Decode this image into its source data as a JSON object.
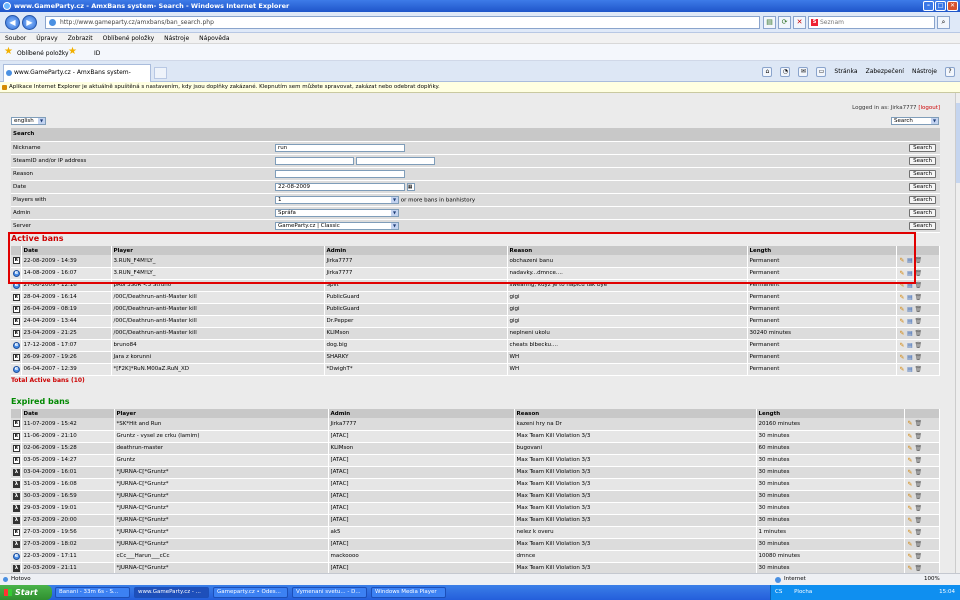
{
  "window": {
    "title": "www.GameParty.cz - AmxBans system- Search - Windows Internet Explorer"
  },
  "address": {
    "url": "http://www.gameparty.cz/amxbans/ban_search.php",
    "search_placeholder": "Seznam"
  },
  "menu": [
    "Soubor",
    "Úpravy",
    "Zobrazit",
    "Oblíbené položky",
    "Nástroje",
    "Nápověda"
  ],
  "favorites": {
    "label": "Oblíbené položky",
    "item": "ID"
  },
  "tab": {
    "title": "www.GameParty.cz - AmxBans system- Search"
  },
  "commands": [
    "Stránka",
    "Zabezpečení",
    "Nástroje"
  ],
  "infobar": "Aplikace Internet Explorer je aktuálně spuštěná s nastavením, kdy jsou doplňky zakázané. Klepnutím sem můžete spravovat, zakázat nebo odebrat doplňky.",
  "header": {
    "logged_text": "Logged in as: Jirka7777",
    "logout": "[logout]",
    "language": "english",
    "mode_select": "Search"
  },
  "search": {
    "title": "Search",
    "button": "Search",
    "rows": [
      {
        "label": "Nickname",
        "value": "run"
      },
      {
        "label": "SteamID and/or IP address",
        "value": ""
      },
      {
        "label": "Reason",
        "value": ""
      },
      {
        "label": "Date",
        "value": "22-08-2009"
      },
      {
        "label": "Players with",
        "value": "1",
        "suffix": "or more bans in banhistory"
      },
      {
        "label": "Admin",
        "value": "Spráfa"
      },
      {
        "label": "Server",
        "value": "GameParty.cz | Classic"
      }
    ]
  },
  "active": {
    "title": "Active bans",
    "columns": [
      "Date",
      "Player",
      "Admin",
      "Reason",
      "Length"
    ],
    "rows": [
      {
        "icon": "cs",
        "date": "22-08-2009 - 14:39",
        "player": "3.RUN_F4M!LY_",
        "admin": "Jirka7777",
        "reason": "obchazeni banu",
        "length": "Permanent"
      },
      {
        "icon": "swirl",
        "date": "14-08-2009 - 16:07",
        "player": "3.RUN_F4M!LY_",
        "admin": "Jirka7777",
        "reason": "nadavky...dmnce....",
        "length": "Permanent"
      },
      {
        "icon": "swirl",
        "date": "27-06-2009 - 12:16",
        "player": "pRoF3SoR <3 Strun0",
        "admin": "Split",
        "reason": "swearing, kdyz je to napicu tak bye",
        "length": "Permanent"
      },
      {
        "icon": "cs",
        "date": "28-04-2009 - 16:14",
        "player": "/00C/Deathrun-anti-Master kill",
        "admin": "PublicGuard",
        "reason": "gigi",
        "length": "Permanent"
      },
      {
        "icon": "cs",
        "date": "26-04-2009 - 08:19",
        "player": "/00C/Deathrun-anti-Master kill",
        "admin": "PublicGuard",
        "reason": "gigi",
        "length": "Permanent"
      },
      {
        "icon": "cs",
        "date": "24-04-2009 - 13:44",
        "player": "/00C/Deathrun-anti-Master kill",
        "admin": "Dr.Pepper",
        "reason": "gigi",
        "length": "Permanent"
      },
      {
        "icon": "cs",
        "date": "23-04-2009 - 21:25",
        "player": "/00C/Deathrun-anti-Master kill",
        "admin": "KLIMson",
        "reason": "neplneni ukolu",
        "length": "30240 minutes"
      },
      {
        "icon": "swirl",
        "date": "17-12-2008 - 17:07",
        "player": "bruno84",
        "admin": "dog.big",
        "reason": "cheats blbecku....",
        "length": "Permanent"
      },
      {
        "icon": "cs",
        "date": "26-09-2007 - 19:26",
        "player": "Jara z korunni",
        "admin": "SHARKY",
        "reason": "WH",
        "length": "Permanent"
      },
      {
        "icon": "swirl",
        "date": "06-04-2007 - 12:39",
        "player": "*[F2K]*RuN.M00aZ.RuN_XD",
        "admin": "*DwighT*",
        "reason": "WH",
        "length": "Permanent"
      }
    ],
    "total": "Total Active bans (10)"
  },
  "expired": {
    "title": "Expired bans",
    "columns": [
      "Date",
      "Player",
      "Admin",
      "Reason",
      "Length"
    ],
    "rows": [
      {
        "icon": "cs",
        "date": "11-07-2009 - 15:42",
        "player": "*SK*Hit and Run",
        "admin": "Jirka7777",
        "reason": "kazeni hry na Dr",
        "length": "20160 minutes"
      },
      {
        "icon": "cs",
        "date": "11-06-2009 - 21:10",
        "player": "Gruntz - vysel ze crku (lamim)",
        "admin": "[ATAC]",
        "reason": "Max Team Kill Violation 3/3",
        "length": "30 minutes"
      },
      {
        "icon": "cs",
        "date": "02-06-2009 - 15:28",
        "player": "deathrun-master",
        "admin": "KLIMson",
        "reason": "bugovani",
        "length": "60 minutes"
      },
      {
        "icon": "cs",
        "date": "03-05-2009 - 14:27",
        "player": "Gruntz",
        "admin": "[ATAC]",
        "reason": "Max Team Kill Violation 3/3",
        "length": "30 minutes"
      },
      {
        "icon": "hl",
        "date": "03-04-2009 - 16:01",
        "player": "*JURNA-C[*Gruntz*",
        "admin": "[ATAC]",
        "reason": "Max Team Kill Violation 3/3",
        "length": "30 minutes"
      },
      {
        "icon": "hl",
        "date": "31-03-2009 - 16:08",
        "player": "*JURNA-C[*Gruntz*",
        "admin": "[ATAC]",
        "reason": "Max Team Kill Violation 3/3",
        "length": "30 minutes"
      },
      {
        "icon": "hl",
        "date": "30-03-2009 - 16:59",
        "player": "*JURNA-C[*Gruntz*",
        "admin": "[ATAC]",
        "reason": "Max Team Kill Violation 3/3",
        "length": "30 minutes"
      },
      {
        "icon": "hl",
        "date": "29-03-2009 - 19:01",
        "player": "*JURNA-C[*Gruntz*",
        "admin": "[ATAC]",
        "reason": "Max Team Kill Violation 3/3",
        "length": "30 minutes"
      },
      {
        "icon": "hl",
        "date": "27-03-2009 - 20:00",
        "player": "*JURNA-C[*Gruntz*",
        "admin": "[ATAC]",
        "reason": "Max Team Kill Violation 3/3",
        "length": "30 minutes"
      },
      {
        "icon": "cs",
        "date": "27-03-2009 - 19:56",
        "player": "*JURNA-C[*Gruntz*",
        "admin": "ak5",
        "reason": "nelez k overu",
        "length": "1 minutes"
      },
      {
        "icon": "hl",
        "date": "27-03-2009 - 18:02",
        "player": "*JURNA-C[*Gruntz*",
        "admin": "[ATAC]",
        "reason": "Max Team Kill Violation 3/3",
        "length": "30 minutes"
      },
      {
        "icon": "swirl",
        "date": "22-03-2009 - 17:11",
        "player": "cCc___Harun___cCc",
        "admin": "mackoooo",
        "reason": "dmnce",
        "length": "10080 minutes"
      },
      {
        "icon": "hl",
        "date": "20-03-2009 - 21:11",
        "player": "*JURNA-C[*Gruntz*",
        "admin": "[ATAC]",
        "reason": "Max Team Kill Violation 3/3",
        "length": "30 minutes"
      }
    ]
  },
  "status": {
    "left": "Hotovo",
    "zone": "Internet",
    "zoom": "100%"
  },
  "taskbar": {
    "start": "Start",
    "items": [
      "Banani - 33m 6s - S...",
      "www.GameParty.cz - ...",
      "Gameparty.cz • Odes...",
      "Vymenani svetu... - D...",
      "Windows Media Player"
    ],
    "tray": {
      "lang": "CS",
      "label": "Plocha",
      "time": "15:04"
    }
  }
}
